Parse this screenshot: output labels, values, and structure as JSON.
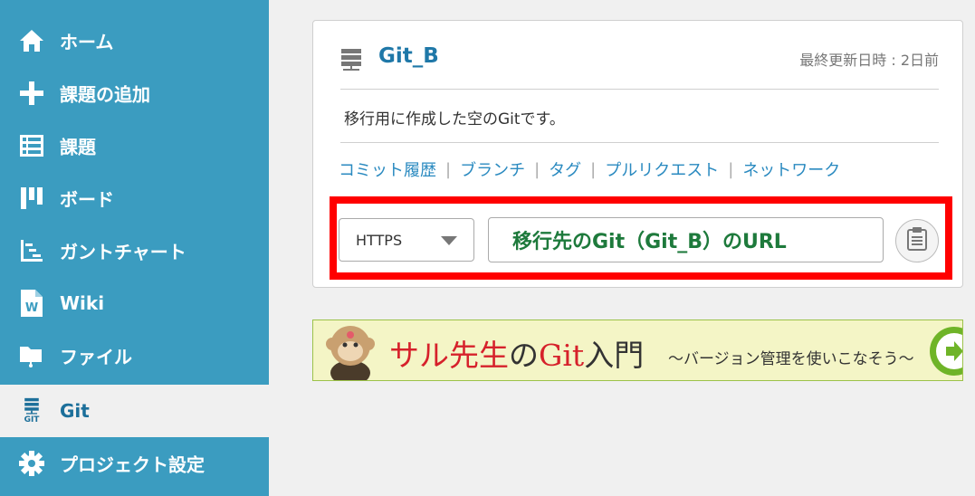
{
  "sidebar": {
    "items": [
      {
        "label": "ホーム",
        "icon": "home-icon"
      },
      {
        "label": "課題の追加",
        "icon": "plus-icon"
      },
      {
        "label": "課題",
        "icon": "list-icon"
      },
      {
        "label": "ボード",
        "icon": "board-icon"
      },
      {
        "label": "ガントチャート",
        "icon": "gantt-icon"
      },
      {
        "label": "Wiki",
        "icon": "wiki-icon"
      },
      {
        "label": "ファイル",
        "icon": "folder-icon"
      },
      {
        "label": "Git",
        "icon": "git-icon",
        "active": true,
        "sub_label": "GIT"
      },
      {
        "label": "プロジェクト設定",
        "icon": "gear-icon"
      }
    ]
  },
  "repo": {
    "name": "Git_B",
    "updated": "最終更新日時 : 2日前",
    "description": "移行用に作成した空のGitです。",
    "links": [
      "コミット履歴",
      "ブランチ",
      "タグ",
      "プルリクエスト",
      "ネットワーク"
    ],
    "protocol": "HTTPS",
    "url_text": "移行先のGit（Git_B）のURL"
  },
  "banner": {
    "title_red1": "サル先生",
    "title_dark1": "の",
    "title_red2": "Git",
    "title_dark2": "入門",
    "subtitle": "〜バージョン管理を使いこなそう〜"
  },
  "colors": {
    "sidebar": "#3b9cc0",
    "link": "#2a8ac0",
    "highlight": "#ff0000",
    "url_text": "#1e7a3c"
  }
}
